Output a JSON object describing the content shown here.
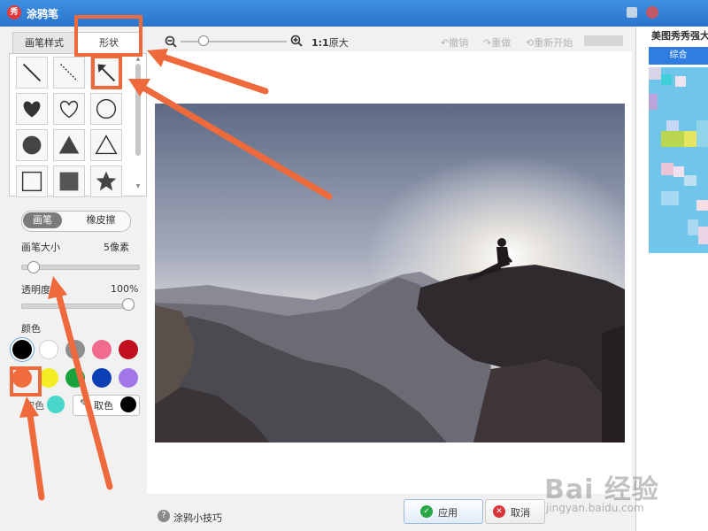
{
  "window": {
    "title": "涂鸦笔",
    "logo": "秀"
  },
  "tabs": [
    {
      "label": "画笔样式"
    },
    {
      "label": "形状"
    }
  ],
  "shapes": [
    "line-icon",
    "dashed-line-icon",
    "arrow-icon",
    "heart-filled-icon",
    "heart-outline-icon",
    "circle-outline-icon",
    "circle-filled-icon",
    "triangle-filled-icon",
    "triangle-outline-icon",
    "square-outline-icon",
    "square-filled-icon",
    "star-icon"
  ],
  "mode": {
    "pen_label": "画笔",
    "eraser_label": "橡皮擦"
  },
  "brush_size": {
    "label": "画笔大小",
    "value_text": "5像素",
    "fraction": 0.06
  },
  "opacity": {
    "label": "透明度",
    "value_text": "100%",
    "fraction": 1.0
  },
  "colors": {
    "label": "颜色",
    "swatches": [
      "#000000",
      "#ffffff",
      "#8e8e8e",
      "#f06b8d",
      "#c0101e",
      "#f26d3d",
      "#f2ee22",
      "#1aa33c",
      "#0a3fb6",
      "#a275e8"
    ],
    "extra": {
      "custom_color": "#47d6c8",
      "pick_label": "取色",
      "pick_label_2": "取色",
      "current_color": "#000000"
    }
  },
  "toolbar": {
    "ratio_text": "1:1",
    "ratio_suffix": "原大",
    "undo_label": "撤销",
    "redo_label": "重做",
    "restart_label": "重新开始",
    "zoom_fraction": 0.18
  },
  "bottom": {
    "tips_label": "涂鸦小技巧",
    "apply_label": "应用",
    "cancel_label": "取消"
  },
  "side_app": {
    "title": "美图秀秀强大",
    "button_label": "综合"
  },
  "watermark": {
    "brand": "Bai 经验",
    "url": "jingyan.baidu.com"
  }
}
